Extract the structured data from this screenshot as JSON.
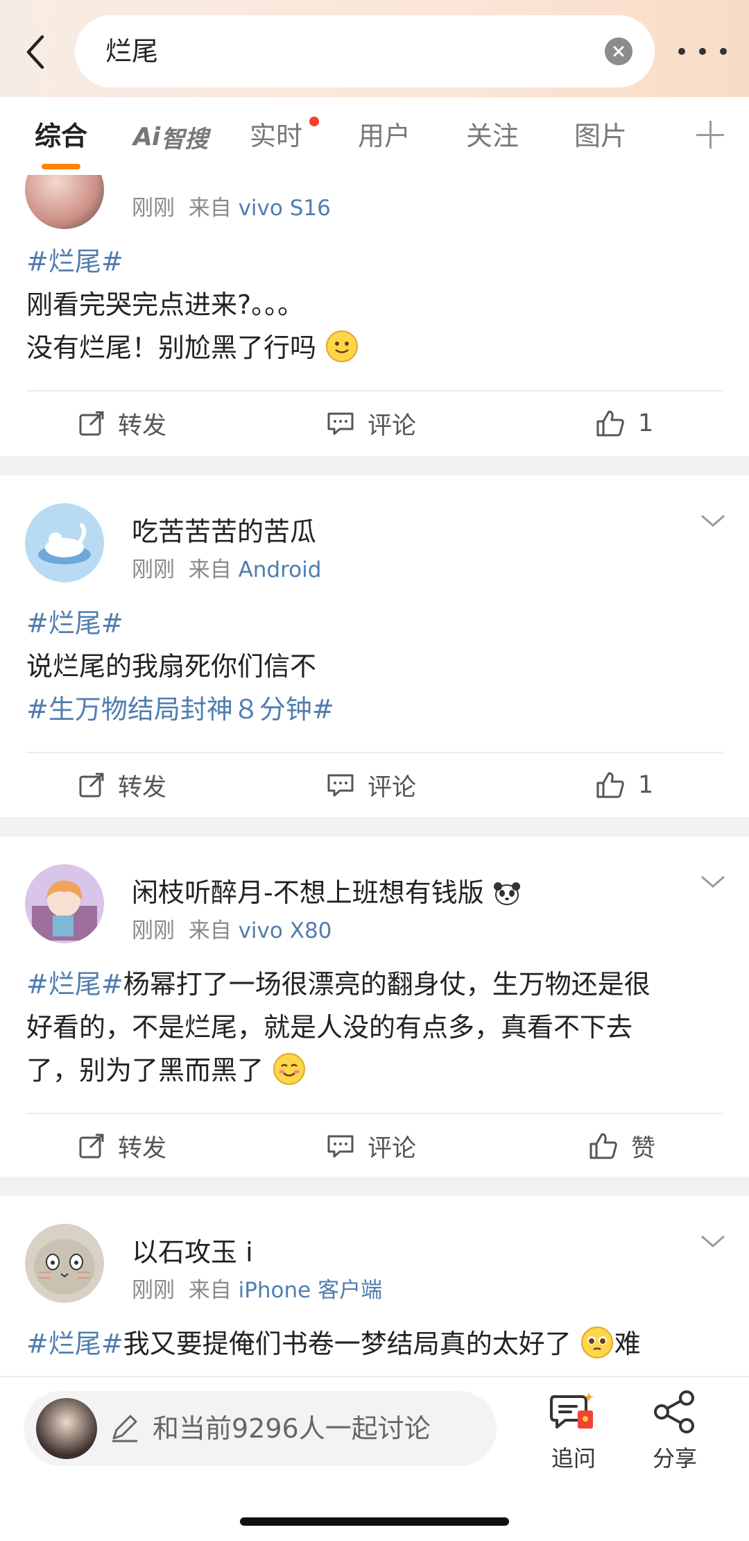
{
  "header": {
    "search_value": "烂尾",
    "icons": {
      "back": "back-arrow-icon",
      "clear": "clear-icon",
      "more": "more-icon"
    }
  },
  "tabs": [
    {
      "label": "综合",
      "active": true
    },
    {
      "label": "Ai",
      "extra": "智搜"
    },
    {
      "label": "实时",
      "has_dot": true
    },
    {
      "label": "用户"
    },
    {
      "label": "关注"
    },
    {
      "label": "图片"
    }
  ],
  "posts": [
    {
      "time": "刚刚",
      "source_prefix": "来自",
      "source": "vivo S16",
      "hashtag": "#烂尾#",
      "lines": [
        "刚看完哭完点进来?。。。",
        "没有烂尾！别尬黑了行吗"
      ],
      "repost_label": "转发",
      "comment_label": "评论",
      "like_label": "1"
    },
    {
      "username": "吃苦苦苦的苦瓜",
      "time": "刚刚",
      "source_prefix": "来自",
      "source": "Android",
      "hashtag": "#烂尾#",
      "line": "说烂尾的我扇死你们信不",
      "hashtag2": "#生万物结局封神８分钟#",
      "repost_label": "转发",
      "comment_label": "评论",
      "like_label": "1"
    },
    {
      "username": "闲枝听醉月-不想上班想有钱版",
      "time": "刚刚",
      "source_prefix": "来自",
      "source": "vivo X80",
      "hashtag": "#烂尾#",
      "text_a": "杨幂打了一场很漂亮的翻身仗，生万物还是很",
      "text_b": "好看的，不是烂尾，就是人没的有点多，真看不下去",
      "text_c": "了，别为了黑而黑了",
      "repost_label": "转发",
      "comment_label": "评论",
      "like_label": "赞"
    },
    {
      "username": "以石攻玉 i",
      "time": "刚刚",
      "source_prefix": "来自",
      "source": "iPhone 客户端",
      "hashtag": "#烂尾#",
      "text_a": "我又要提俺们书卷一梦结局真的太好了",
      "text_b": "难"
    }
  ],
  "bottom": {
    "compose_placeholder": "和当前9296人一起讨论",
    "ask_label": "追问",
    "share_label": "分享"
  },
  "colors": {
    "accent": "#ff8200",
    "link": "#507daf",
    "dot": "#ff3b30"
  }
}
